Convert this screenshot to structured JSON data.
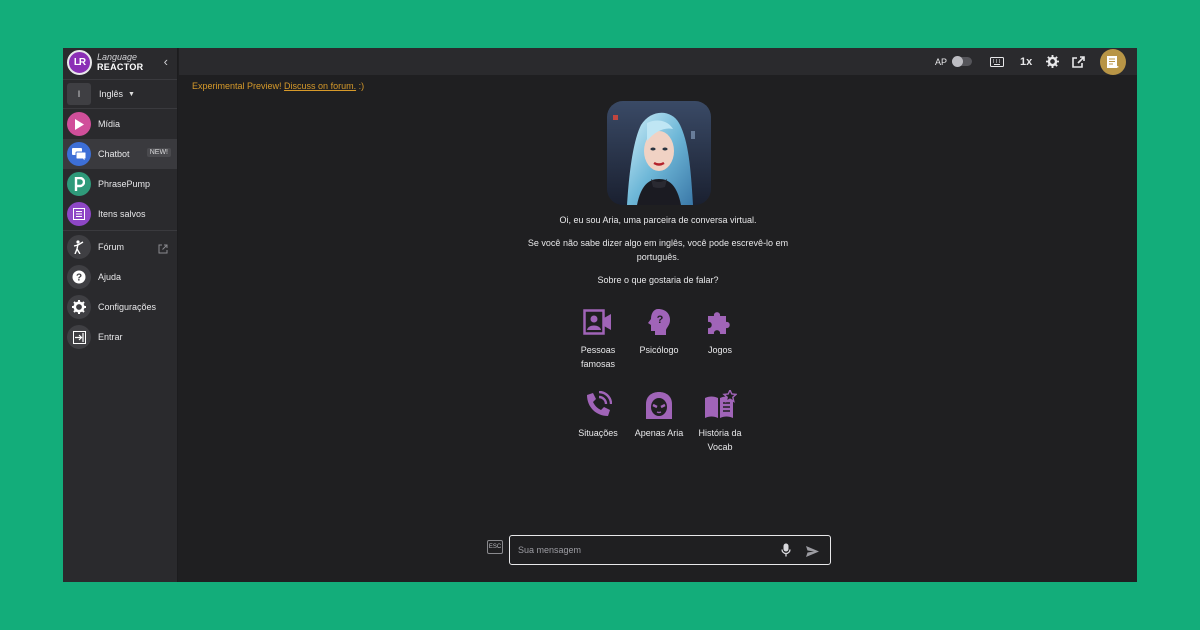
{
  "app": {
    "logo_initials": "LR",
    "logo_line1": "Language",
    "logo_line2": "REACTOR"
  },
  "sidebar": {
    "language": {
      "badge": "I",
      "label": "Inglês"
    },
    "items": [
      {
        "label": "Mídia",
        "color": "#d04f9a",
        "icon": "play-icon"
      },
      {
        "label": "Chatbot",
        "color": "#3d6fd6",
        "icon": "chat-icon",
        "badge": "NEW!",
        "active": true
      },
      {
        "label": "PhrasePump",
        "color": "#2f9a7a",
        "icon": "p-icon"
      },
      {
        "label": "Itens salvos",
        "color": "#8e47c6",
        "icon": "list-icon"
      },
      {
        "label": "Fórum",
        "color": "#3f3f43",
        "icon": "figure-icon"
      },
      {
        "label": "Ajuda",
        "color": "#3f3f43",
        "icon": "help-icon"
      },
      {
        "label": "Configurações",
        "color": "#3f3f43",
        "icon": "gear-icon"
      },
      {
        "label": "Entrar",
        "color": "#3f3f43",
        "icon": "login-icon"
      }
    ]
  },
  "topbar": {
    "ap_label": "AP",
    "speed": "1x",
    "icons": [
      "keyboard-icon",
      "gear-icon",
      "share-icon",
      "avatar"
    ]
  },
  "main": {
    "preview_text": "Experimental Preview! ",
    "preview_link": "Discuss on forum.",
    "preview_tail": " :)",
    "intro": "Oi, eu sou Aria, uma parceira de conversa virtual.",
    "hint_line1": "Se você não sabe dizer algo em inglês, você pode escrevê-lo em",
    "hint_line2": "português.",
    "question": "Sobre o que gostaria de falar?",
    "topic_color": "#a064b8",
    "topics": [
      {
        "line1": "Pessoas",
        "line2": "famosas",
        "icon": "contact-video-icon"
      },
      {
        "line1": "Psicólogo",
        "line2": "",
        "icon": "head-question-icon"
      },
      {
        "line1": "Jogos",
        "line2": "",
        "icon": "puzzle-icon"
      },
      {
        "line1": "Situações",
        "line2": "",
        "icon": "phone-call-icon"
      },
      {
        "line1": "Apenas Aria",
        "line2": "",
        "icon": "aria-face-icon"
      },
      {
        "line1": "História da",
        "line2": "Vocab",
        "icon": "book-star-icon"
      }
    ]
  },
  "composer": {
    "esc_label": "ESC",
    "placeholder": "Sua mensagem"
  }
}
